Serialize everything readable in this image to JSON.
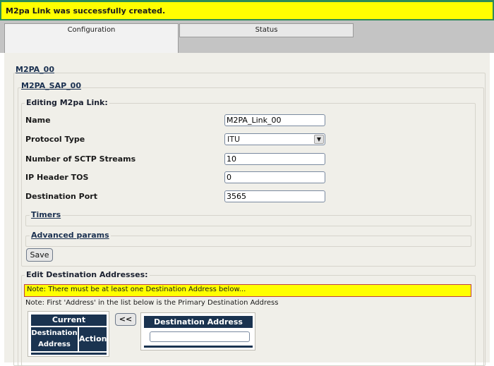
{
  "banner": {
    "message": "M2pa Link was successfully created."
  },
  "tabs": [
    {
      "label": "Configuration",
      "active": true
    },
    {
      "label": "Status",
      "active": false
    }
  ],
  "breadcrumb": {
    "level1": "M2PA_00",
    "level2": "M2PA_SAP_00"
  },
  "form": {
    "legend": "Editing M2pa Link:",
    "fields": {
      "name": {
        "label": "Name",
        "value": "M2PA_Link_00"
      },
      "protocol_type": {
        "label": "Protocol Type",
        "value": "ITU"
      },
      "sctp_streams": {
        "label": "Number of SCTP Streams",
        "value": "10"
      },
      "ip_header_tos": {
        "label": "IP Header TOS",
        "value": "0"
      },
      "destination_port": {
        "label": "Destination Port",
        "value": "3565"
      }
    },
    "timers_label": "Timers",
    "advanced_label": "Advanced params",
    "save_label": "Save"
  },
  "destinations": {
    "legend": "Edit Destination Addresses:",
    "warning": "Note: There must be at least one Destination Address below...",
    "note": "Note: First 'Address' in the list below is the Primary Destination Address",
    "current_table": {
      "title": "Current",
      "col_address": "Destination Address",
      "col_action": "Action"
    },
    "move_label": "<<",
    "dest_table": {
      "title": "Destination Address",
      "input_value": ""
    }
  },
  "colors": {
    "banner_bg": "#ffff00",
    "banner_border": "#2e8b57",
    "header_bg": "#1a3350",
    "panel_bg": "#f0efe9"
  }
}
